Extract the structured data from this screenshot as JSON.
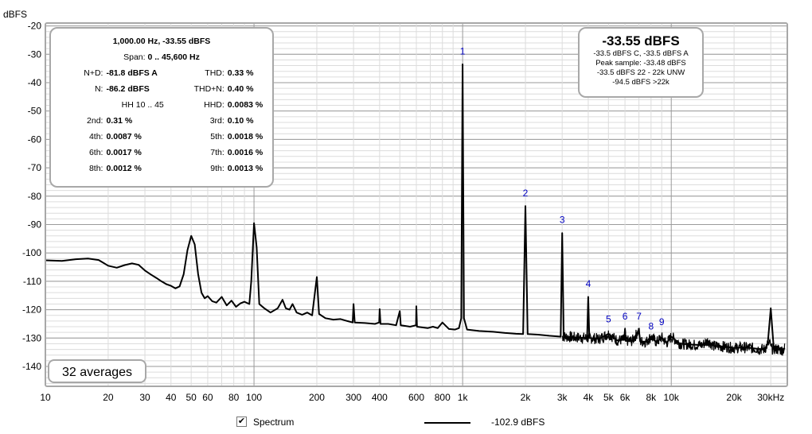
{
  "chart_data": {
    "type": "line",
    "title": "",
    "ylabel": "dBFS",
    "xlabel": "",
    "x_scale": "log",
    "xlim": [
      10,
      36000
    ],
    "ylim": [
      -147,
      -19
    ],
    "grid": true,
    "x_ticks": [
      {
        "value": 10,
        "label": "10"
      },
      {
        "value": 20,
        "label": "20"
      },
      {
        "value": 30,
        "label": "30"
      },
      {
        "value": 40,
        "label": "40"
      },
      {
        "value": 50,
        "label": "50"
      },
      {
        "value": 60,
        "label": "60"
      },
      {
        "value": 80,
        "label": "80"
      },
      {
        "value": 100,
        "label": "100"
      },
      {
        "value": 200,
        "label": "200"
      },
      {
        "value": 300,
        "label": "300"
      },
      {
        "value": 400,
        "label": "400"
      },
      {
        "value": 600,
        "label": "600"
      },
      {
        "value": 800,
        "label": "800"
      },
      {
        "value": 1000,
        "label": "1k"
      },
      {
        "value": 2000,
        "label": "2k"
      },
      {
        "value": 3000,
        "label": "3k"
      },
      {
        "value": 4000,
        "label": "4k"
      },
      {
        "value": 5000,
        "label": "5k"
      },
      {
        "value": 6000,
        "label": "6k"
      },
      {
        "value": 8000,
        "label": "8k"
      },
      {
        "value": 10000,
        "label": "10k"
      },
      {
        "value": 20000,
        "label": "20k"
      },
      {
        "value": 30000,
        "label": "30kHz"
      }
    ],
    "y_ticks": [
      -20,
      -30,
      -40,
      -50,
      -60,
      -70,
      -80,
      -90,
      -100,
      -110,
      -120,
      -130,
      -140
    ],
    "series": [
      {
        "name": "Spectrum",
        "color": "#000000",
        "points": [
          [
            10,
            -102.6
          ],
          [
            12,
            -102.8
          ],
          [
            14,
            -102.2
          ],
          [
            16,
            -102.0
          ],
          [
            18,
            -102.5
          ],
          [
            20,
            -104.5
          ],
          [
            22,
            -105.2
          ],
          [
            24,
            -104.3
          ],
          [
            26,
            -103.7
          ],
          [
            28,
            -104.2
          ],
          [
            30,
            -106.2
          ],
          [
            32,
            -107.6
          ],
          [
            34,
            -108.8
          ],
          [
            36,
            -110.0
          ],
          [
            38,
            -111.0
          ],
          [
            40,
            -111.6
          ],
          [
            42,
            -112.5
          ],
          [
            44,
            -111.8
          ],
          [
            46,
            -107.5
          ],
          [
            48,
            -99.0
          ],
          [
            50,
            -94.0
          ],
          [
            52,
            -97.0
          ],
          [
            54,
            -107.5
          ],
          [
            56,
            -114.0
          ],
          [
            58,
            -116.0
          ],
          [
            60,
            -115.2
          ],
          [
            63,
            -117.0
          ],
          [
            66,
            -117.5
          ],
          [
            70,
            -115.5
          ],
          [
            74,
            -118.5
          ],
          [
            78,
            -116.8
          ],
          [
            82,
            -119.0
          ],
          [
            86,
            -117.8
          ],
          [
            90,
            -117.2
          ],
          [
            95,
            -118.0
          ],
          [
            97,
            -110.0
          ],
          [
            100,
            -89.5
          ],
          [
            103,
            -98.0
          ],
          [
            106,
            -118.0
          ],
          [
            112,
            -119.5
          ],
          [
            120,
            -121.0
          ],
          [
            130,
            -119.5
          ],
          [
            137,
            -116.5
          ],
          [
            142,
            -119.5
          ],
          [
            148,
            -120.0
          ],
          [
            153,
            -118.0
          ],
          [
            160,
            -121.0
          ],
          [
            170,
            -121.8
          ],
          [
            180,
            -121.0
          ],
          [
            190,
            -122.0
          ],
          [
            200,
            -108.5
          ],
          [
            205,
            -121.5
          ],
          [
            220,
            -123.0
          ],
          [
            240,
            -123.5
          ],
          [
            260,
            -123.3
          ],
          [
            280,
            -124.0
          ],
          [
            297,
            -124.5
          ],
          [
            300,
            -118.0
          ],
          [
            304,
            -124.5
          ],
          [
            340,
            -124.7
          ],
          [
            380,
            -125.0
          ],
          [
            398,
            -124.5
          ],
          [
            400,
            -119.8
          ],
          [
            404,
            -125.0
          ],
          [
            440,
            -125.0
          ],
          [
            480,
            -125.5
          ],
          [
            500,
            -120.5
          ],
          [
            505,
            -125.5
          ],
          [
            560,
            -126.0
          ],
          [
            598,
            -125.5
          ],
          [
            600,
            -118.8
          ],
          [
            604,
            -126.0
          ],
          [
            680,
            -126.5
          ],
          [
            720,
            -126.0
          ],
          [
            760,
            -126.5
          ],
          [
            800,
            -124.5
          ],
          [
            860,
            -126.8
          ],
          [
            920,
            -127.0
          ],
          [
            960,
            -126.5
          ],
          [
            985,
            -123.0
          ],
          [
            1000,
            -33.55
          ],
          [
            1015,
            -123.0
          ],
          [
            1050,
            -127.0
          ],
          [
            1200,
            -127.5
          ],
          [
            1400,
            -127.8
          ],
          [
            1600,
            -128.2
          ],
          [
            1800,
            -128.5
          ],
          [
            1950,
            -128.6
          ],
          [
            2000,
            -83.5
          ],
          [
            2050,
            -128.6
          ],
          [
            2300,
            -128.8
          ],
          [
            2600,
            -129.2
          ],
          [
            2950,
            -129.5
          ],
          [
            3000,
            -93.0
          ],
          [
            3050,
            -129.5
          ],
          [
            3500,
            -129.8
          ],
          [
            3950,
            -130.0
          ],
          [
            4000,
            -115.5
          ],
          [
            4050,
            -130.0
          ],
          [
            4500,
            -130.3
          ],
          [
            5000,
            -128.5
          ],
          [
            5500,
            -130.8
          ],
          [
            5950,
            -130.6
          ],
          [
            6000,
            -126.8
          ],
          [
            6050,
            -131.0
          ],
          [
            6500,
            -131.0
          ],
          [
            7000,
            -127.2
          ],
          [
            7100,
            -131.2
          ],
          [
            7600,
            -131.3
          ],
          [
            8000,
            -129.5
          ],
          [
            8500,
            -131.5
          ],
          [
            9000,
            -129.8
          ],
          [
            9500,
            -131.8
          ],
          [
            10000,
            -129.5
          ],
          [
            11000,
            -132.0
          ],
          [
            12500,
            -132.3
          ],
          [
            14000,
            -132.5
          ],
          [
            15000,
            -131.0
          ],
          [
            16000,
            -132.8
          ],
          [
            18000,
            -133.0
          ],
          [
            20000,
            -133.5
          ],
          [
            22000,
            -133.3
          ],
          [
            24000,
            -133.5
          ],
          [
            26000,
            -133.8
          ],
          [
            28000,
            -134.0
          ],
          [
            29000,
            -132.0
          ],
          [
            30000,
            -119.5
          ],
          [
            31000,
            -133.8
          ],
          [
            33000,
            -134.0
          ],
          [
            34000,
            -134.3
          ],
          [
            35000,
            -133.5
          ]
        ]
      }
    ],
    "harmonic_markers": [
      {
        "label": "1",
        "x": 1000,
        "y": -30
      },
      {
        "label": "2",
        "x": 2000,
        "y": -80
      },
      {
        "label": "3",
        "x": 3000,
        "y": -89.5
      },
      {
        "label": "4",
        "x": 4000,
        "y": -112
      },
      {
        "label": "5",
        "x": 5000,
        "y": -124.5
      },
      {
        "label": "6",
        "x": 6000,
        "y": -123.5
      },
      {
        "label": "7",
        "x": 7000,
        "y": -123.5
      },
      {
        "label": "8",
        "x": 8000,
        "y": -127.0
      },
      {
        "label": "9",
        "x": 9000,
        "y": -125.5
      }
    ]
  },
  "stats": {
    "header": "1,000.00 Hz, -33.55 dBFS",
    "span_label": "Span:",
    "span_value": "0 .. 45,600 Hz",
    "rows": [
      {
        "l1": "N+D:",
        "v1": "-81.8 dBFS A",
        "l2": "THD:",
        "v2": "0.33 %"
      },
      {
        "l1": "N:",
        "v1": "-86.2 dBFS",
        "l2": "THD+N:",
        "v2": "0.40 %"
      },
      {
        "l1": "",
        "v1": "HH 10 .. 45",
        "l2": "HHD:",
        "v2": "0.0083 %"
      },
      {
        "l1": "2nd:",
        "v1": "0.31 %",
        "l2": "3rd:",
        "v2": "0.10 %"
      },
      {
        "l1": "4th:",
        "v1": "0.0087 %",
        "l2": "5th:",
        "v2": "0.0018 %"
      },
      {
        "l1": "6th:",
        "v1": "0.0017 %",
        "l2": "7th:",
        "v2": "0.0016 %"
      },
      {
        "l1": "8th:",
        "v1": "0.0012 %",
        "l2": "9th:",
        "v2": "0.0013 %"
      }
    ]
  },
  "level": {
    "main": "-33.55 dBFS",
    "line1": "-33.5 dBFS C, -33.5 dBFS A",
    "line2": "Peak sample: -33.48 dBFS",
    "line3": "-33.5 dBFS 22 - 22k UNW",
    "line4": "-94.5 dBFS >22k"
  },
  "averages": "32 averages",
  "legend": {
    "checkbox_checked": true,
    "label": "Spectrum",
    "value": "-102.9 dBFS"
  },
  "colors": {
    "grid_major": "#9a9a9a",
    "grid_minor": "#dcdcdc",
    "marker": "#0000c0",
    "plot_border": "#a8a8a8"
  }
}
